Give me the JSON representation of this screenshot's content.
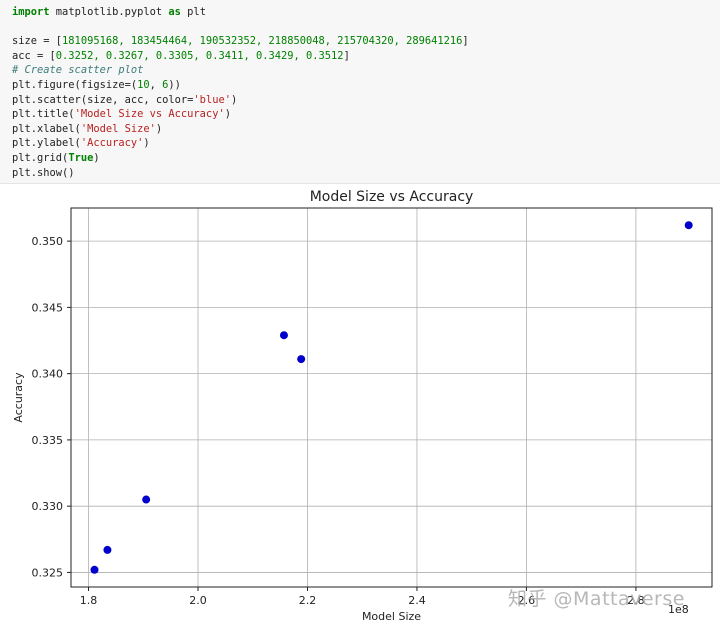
{
  "code_cell": {
    "lines": [
      [
        {
          "t": "import",
          "c": "kw"
        },
        {
          "t": " matplotlib.pyplot ",
          "c": "plain"
        },
        {
          "t": "as",
          "c": "kw"
        },
        {
          "t": " plt",
          "c": "plain"
        }
      ],
      [],
      [
        {
          "t": "size = [",
          "c": "plain"
        },
        {
          "t": "181095168, 183454464, 190532352, 218850048, 215704320, 289641216",
          "c": "num"
        },
        {
          "t": "]",
          "c": "plain"
        }
      ],
      [
        {
          "t": "acc = [",
          "c": "plain"
        },
        {
          "t": "0.3252, 0.3267, 0.3305, 0.3411, 0.3429, 0.3512",
          "c": "num"
        },
        {
          "t": "]",
          "c": "plain"
        }
      ],
      [
        {
          "t": "# Create scatter plot",
          "c": "comment"
        }
      ],
      [
        {
          "t": "plt.figure(figsize=(",
          "c": "plain"
        },
        {
          "t": "10",
          "c": "num"
        },
        {
          "t": ", ",
          "c": "plain"
        },
        {
          "t": "6",
          "c": "num"
        },
        {
          "t": "))",
          "c": "plain"
        }
      ],
      [
        {
          "t": "plt.scatter(size, acc, color=",
          "c": "plain"
        },
        {
          "t": "'blue'",
          "c": "str"
        },
        {
          "t": ")",
          "c": "plain"
        }
      ],
      [
        {
          "t": "plt.title(",
          "c": "plain"
        },
        {
          "t": "'Model Size vs Accuracy'",
          "c": "str"
        },
        {
          "t": ")",
          "c": "plain"
        }
      ],
      [
        {
          "t": "plt.xlabel(",
          "c": "plain"
        },
        {
          "t": "'Model Size'",
          "c": "str"
        },
        {
          "t": ")",
          "c": "plain"
        }
      ],
      [
        {
          "t": "plt.ylabel(",
          "c": "plain"
        },
        {
          "t": "'Accuracy'",
          "c": "str"
        },
        {
          "t": ")",
          "c": "plain"
        }
      ],
      [
        {
          "t": "plt.grid(",
          "c": "plain"
        },
        {
          "t": "True",
          "c": "kw"
        },
        {
          "t": ")",
          "c": "plain"
        }
      ],
      [
        {
          "t": "plt.show()",
          "c": "plain"
        }
      ]
    ]
  },
  "syntax_colors": {
    "kw": "#008000",
    "num": "#008000",
    "str": "#ba2121",
    "comment": "#3d7b7b",
    "plain": "#222222"
  },
  "chart_data": {
    "type": "scatter",
    "title": "Model Size vs Accuracy",
    "xlabel": "Model Size",
    "ylabel": "Accuracy",
    "x_offset_label": "1e8",
    "x": [
      181095168,
      183454464,
      190532352,
      218850048,
      215704320,
      289641216
    ],
    "y": [
      0.3252,
      0.3267,
      0.3305,
      0.3411,
      0.3429,
      0.3512
    ],
    "color": "#0000cc",
    "xlim": [
      176800000,
      293900000
    ],
    "ylim": [
      0.3239,
      0.3525
    ],
    "xticks": [
      180000000,
      200000000,
      220000000,
      240000000,
      260000000,
      280000000
    ],
    "xtick_labels": [
      "1.8",
      "2.0",
      "2.2",
      "2.4",
      "2.6",
      "2.8"
    ],
    "yticks": [
      0.325,
      0.33,
      0.335,
      0.34,
      0.345,
      0.35
    ],
    "ytick_labels": [
      "0.325",
      "0.330",
      "0.335",
      "0.340",
      "0.345",
      "0.350"
    ],
    "grid": true
  },
  "watermark": "知乎 @Mattaverse"
}
